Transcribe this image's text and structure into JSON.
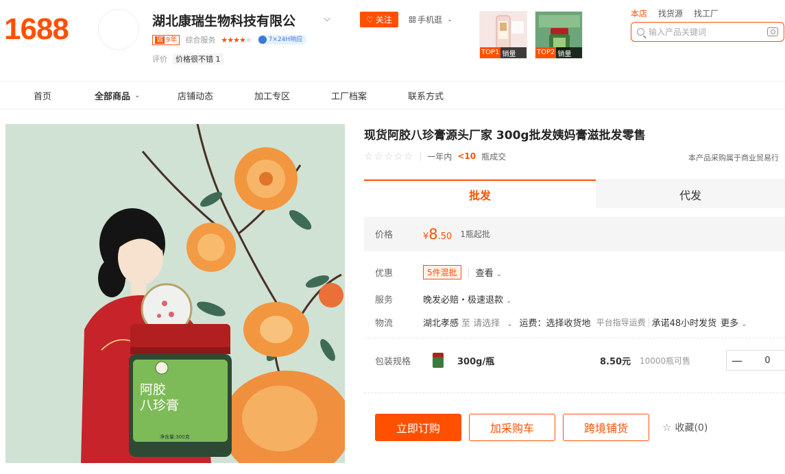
{
  "header": {
    "logo": "1688",
    "shop_name": "湖北康瑞生物科技有限公",
    "year_badge": {
      "icon": "诚",
      "text": "9年"
    },
    "service_label": "综合服务",
    "service_stars": 4,
    "response_badge": "7×24H响应",
    "review_label": "评价",
    "review_tag": "价格很不错",
    "review_count": "1",
    "follow_label": "关注",
    "mobile_label": "手机逛",
    "top_products": [
      {
        "rank": "TOP1",
        "label": "销量"
      },
      {
        "rank": "TOP2",
        "label": "销量"
      }
    ],
    "search_tabs": [
      "本店",
      "找货源",
      "找工厂"
    ],
    "search_placeholder": "输入产品关键词"
  },
  "nav": [
    "首页",
    "全部商品",
    "店铺动态",
    "加工专区",
    "工厂档案",
    "联系方式"
  ],
  "product": {
    "image_text": {
      "brand_line1": "阿胶",
      "brand_line2": "八珍膏",
      "net": "净含量:300克"
    },
    "title": "现货阿胶八珍膏源头厂家 300g批发姨妈膏滋批发零售",
    "rating_text_pre": "一年内",
    "rating_highlight": "<10",
    "rating_text_post": "瓶成交",
    "trade_note": "本产品采购属于商业贸易行",
    "tabs": [
      "批发",
      "代发"
    ],
    "price_label": "价格",
    "price_symbol": "¥",
    "price_int": "8",
    "price_dec": ".50",
    "moq": "1瓶起批",
    "promo_label": "优惠",
    "promo_tag": "5件混批",
    "promo_link": "查看",
    "service_label": "服务",
    "service_text": "晚发必赔・极速退款",
    "logistics_label": "物流",
    "logistics_from": "湖北孝感",
    "logistics_to": "至 请选择",
    "freight": "运费：选择收货地",
    "platform_fee": "平台指导运费",
    "ship_promise": "承诺48小时发货",
    "more": "更多",
    "sku_label": "包装规格",
    "sku_name": "300g/瓶",
    "sku_price": "8.50元",
    "sku_stock": "10000瓶可售",
    "quantity": "0",
    "buy_now": "立即订购",
    "add_cart": "加采购车",
    "cross_border": "跨境铺货",
    "favorite": "收藏(0)"
  }
}
